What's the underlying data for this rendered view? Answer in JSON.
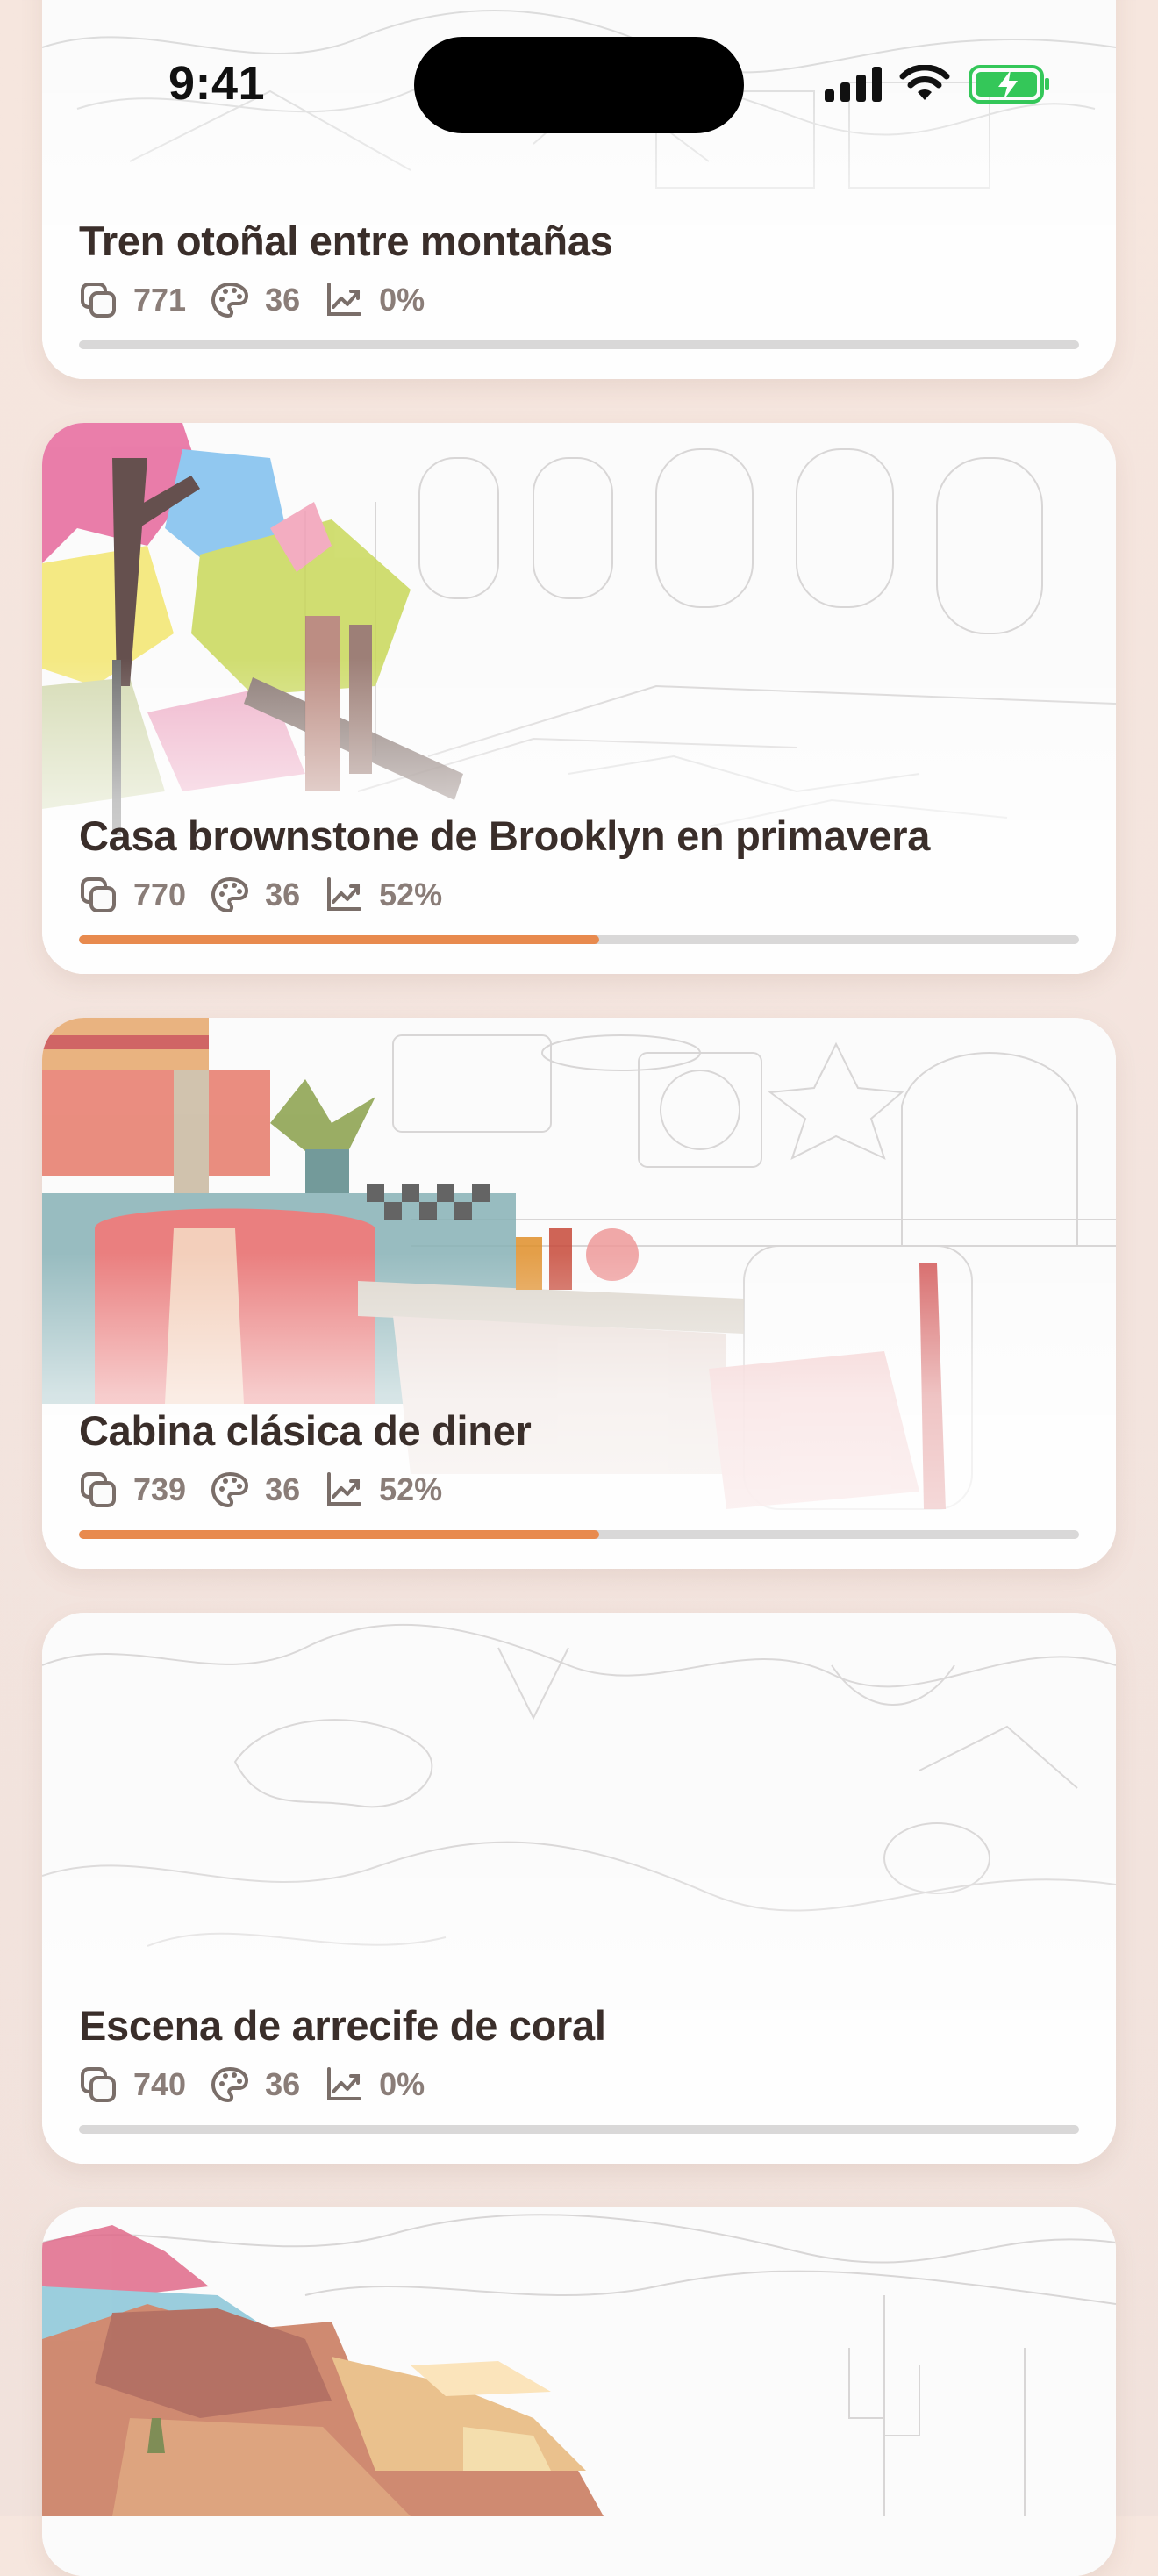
{
  "status_bar": {
    "time": "9:41",
    "icons": [
      "cellular-signal-icon",
      "wifi-icon",
      "battery-charging-icon"
    ],
    "battery_color": "#34c759"
  },
  "accent_color": "#e88a4e",
  "cards": [
    {
      "title": "Tren otoñal entre montañas",
      "pieces": "771",
      "colors": "36",
      "progress_label": "0%",
      "progress": 0.0
    },
    {
      "title": "Casa brownstone de Brooklyn en primavera",
      "pieces": "770",
      "colors": "36",
      "progress_label": "52%",
      "progress": 0.52
    },
    {
      "title": "Cabina clásica de diner",
      "pieces": "739",
      "colors": "36",
      "progress_label": "52%",
      "progress": 0.52
    },
    {
      "title": "Escena de arrecife de coral",
      "pieces": "740",
      "colors": "36",
      "progress_label": "0%",
      "progress": 0.0
    }
  ],
  "icons": {
    "pieces": "layers-icon",
    "colors": "palette-icon",
    "progress": "trend-chart-icon"
  }
}
